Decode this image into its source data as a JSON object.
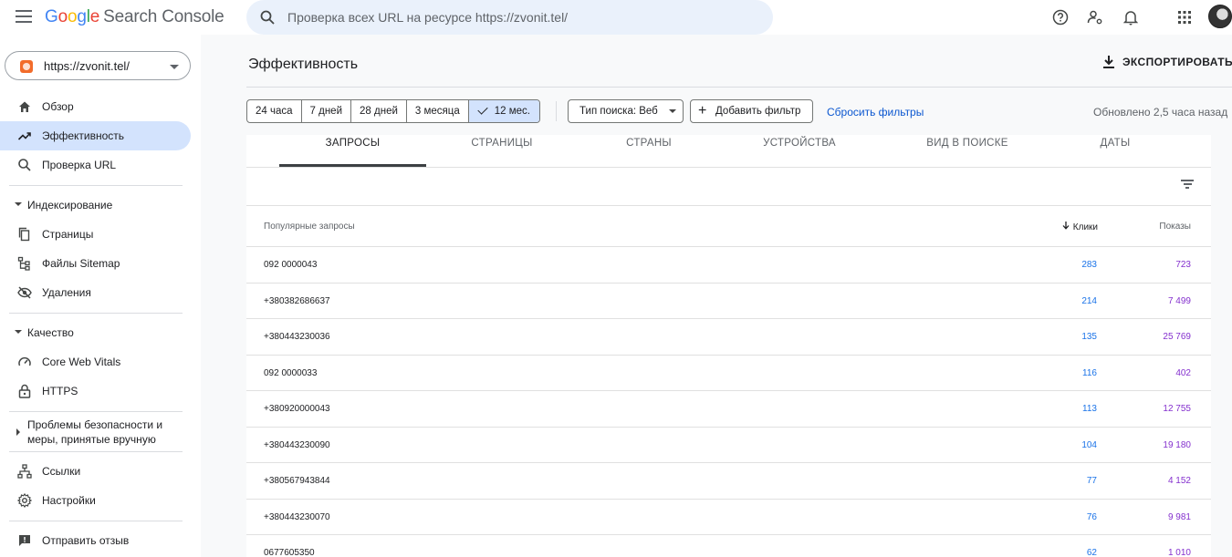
{
  "header": {
    "logo_google": "Google",
    "logo_product": "Search Console",
    "search_placeholder": "Проверка всех URL на ресурсе https://zvonit.tel/"
  },
  "sidebar": {
    "property": "https://zvonit.tel/",
    "items": [
      {
        "label": "Обзор",
        "icon": "home-icon"
      },
      {
        "label": "Эффективность",
        "icon": "trending-up-icon",
        "active": true
      },
      {
        "label": "Проверка URL",
        "icon": "search-icon"
      }
    ],
    "sections": {
      "indexing": {
        "title": "Индексирование",
        "items": [
          {
            "label": "Страницы",
            "icon": "pages-icon"
          },
          {
            "label": "Файлы Sitemap",
            "icon": "sitemap-icon"
          },
          {
            "label": "Удаления",
            "icon": "eye-off-icon"
          }
        ]
      },
      "quality": {
        "title": "Качество",
        "items": [
          {
            "label": "Core Web Vitals",
            "icon": "gauge-icon"
          },
          {
            "label": "HTTPS",
            "icon": "lock-icon"
          }
        ]
      },
      "security": {
        "title_line1": "Проблемы безопасности и",
        "title_line2": "меры, принятые вручную"
      }
    },
    "bottom_items": [
      {
        "label": "Ссылки",
        "icon": "links-icon"
      },
      {
        "label": "Настройки",
        "icon": "settings-icon"
      },
      {
        "label": "Отправить отзыв",
        "icon": "feedback-icon"
      }
    ]
  },
  "main": {
    "title": "Эффективность",
    "export_label": "ЭКСПОРТИРОВАТЬ",
    "ranges": [
      "24 часа",
      "7 дней",
      "28 дней",
      "3 месяца",
      "12 мес."
    ],
    "selected_range": "12 мес.",
    "search_type": "Тип поиска: Веб",
    "add_filter": "Добавить фильтр",
    "reset_filters": "Сбросить фильтры",
    "updated": "Обновлено 2,5 часа назад",
    "tabs": [
      "ЗАПРОСЫ",
      "СТРАНИЦЫ",
      "СТРАНЫ",
      "УСТРОЙСТВА",
      "ВИД В ПОИСКЕ",
      "ДАТЫ"
    ],
    "table": {
      "col_query": "Популярные запросы",
      "col_clicks": "Клики",
      "col_impressions": "Показы",
      "rows": [
        {
          "query": "092 0000043",
          "clicks": "283",
          "impressions": "723"
        },
        {
          "query": "+380382686637",
          "clicks": "214",
          "impressions": "7 499"
        },
        {
          "query": "+380443230036",
          "clicks": "135",
          "impressions": "25 769"
        },
        {
          "query": "092 0000033",
          "clicks": "116",
          "impressions": "402"
        },
        {
          "query": "+380920000043",
          "clicks": "113",
          "impressions": "12 755"
        },
        {
          "query": "+380443230090",
          "clicks": "104",
          "impressions": "19 180"
        },
        {
          "query": "+380567943844",
          "clicks": "77",
          "impressions": "4 152"
        },
        {
          "query": "+380443230070",
          "clicks": "76",
          "impressions": "9 981"
        },
        {
          "query": "0677605350",
          "clicks": "62",
          "impressions": "1 010"
        }
      ]
    }
  },
  "colors": {
    "accent": "#0b57d0",
    "clicks": "#1a73e8",
    "impressions": "#8430ce",
    "active_nav": "#d3e3fd"
  }
}
